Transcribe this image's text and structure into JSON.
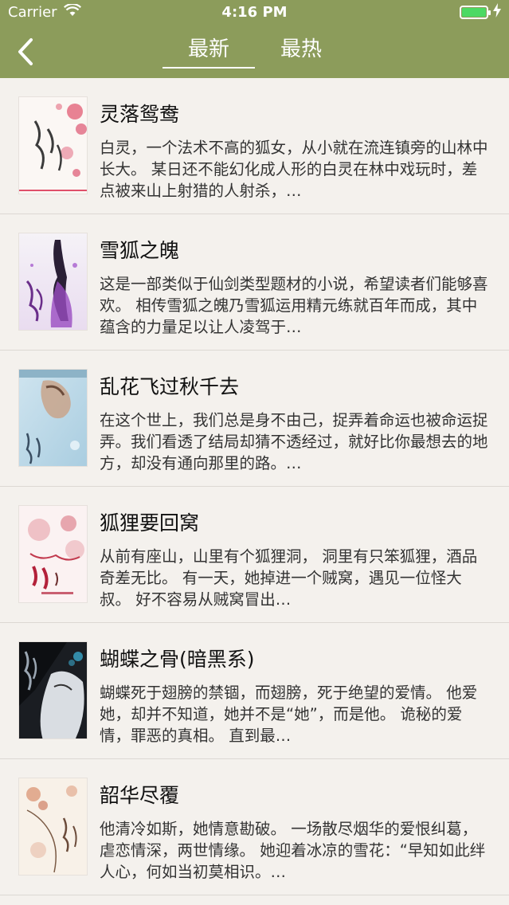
{
  "status": {
    "carrier": "Carrier",
    "time": "4:16 PM"
  },
  "nav": {
    "tabs": [
      {
        "label": "最新",
        "active": true
      },
      {
        "label": "最热",
        "active": false
      }
    ]
  },
  "colors": {
    "header": "#8c9c5b",
    "background": "#f4f1ed",
    "battery": "#4cd964"
  },
  "books": [
    {
      "title": "灵落鸳鸯",
      "description": "白灵，一个法术不高的狐女，从小就在流连镇旁的山林中长大。 某日还不能幻化成人形的白灵在林中戏玩时，差点被来山上射猎的人射杀，…"
    },
    {
      "title": "雪狐之魄",
      "description": "这是一部类似于仙剑类型题材的小说，希望读者们能够喜欢。 相传雪狐之魄乃雪狐运用精元练就百年而成，其中蕴含的力量足以让人凌驾于…"
    },
    {
      "title": "乱花飞过秋千去",
      "description": "在这个世上，我们总是身不由己，捉弄着命运也被命运捉弄。我们看透了结局却猜不透经过，就好比你最想去的地方，却没有通向那里的路。…"
    },
    {
      "title": "狐狸要回窝",
      "description": "从前有座山，山里有个狐狸洞， 洞里有只笨狐狸，酒品奇差无比。 有一天，她掉进一个贼窝，遇见一位怪大叔。 好不容易从贼窝冒出…"
    },
    {
      "title": "蝴蝶之骨(暗黑系)",
      "description": "蝴蝶死于翅膀的禁锢，而翅膀，死于绝望的爱情。 他爱她，却并不知道，她并不是“她”，而是他。 诡秘的爱情，罪恶的真相。 直到最…"
    },
    {
      "title": "韶华尽覆",
      "description": "他清冷如斯，她情意勘破。 一场散尽烟华的爱恨纠葛，虐恋情深，两世情缘。 她迎着冰凉的雪花：“早知如此绊人心，何如当初莫相识。…"
    }
  ]
}
